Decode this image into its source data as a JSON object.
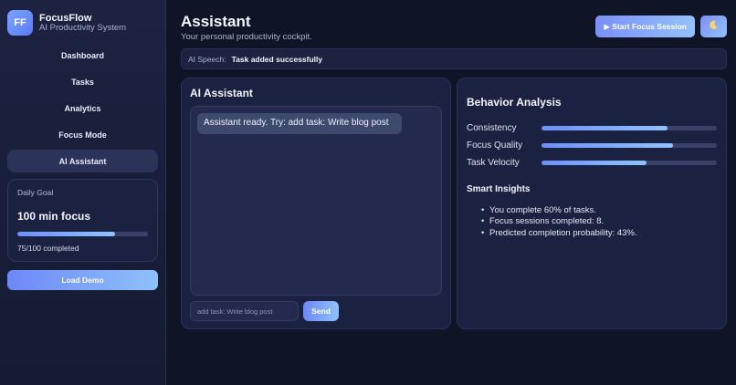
{
  "brand": {
    "logo_text": "FF",
    "name": "FocusFlow",
    "subtitle": "AI Productivity System"
  },
  "sidebar": {
    "items": [
      {
        "label": "Dashboard",
        "active": false
      },
      {
        "label": "Tasks",
        "active": false
      },
      {
        "label": "Analytics",
        "active": false
      },
      {
        "label": "Focus Mode",
        "active": false
      },
      {
        "label": "AI Assistant",
        "active": true
      }
    ],
    "daily_goal": {
      "label": "Daily Goal",
      "value": "100 min focus",
      "progress": 0.75,
      "status": "75/100 completed"
    },
    "load_demo_label": "Load Demo"
  },
  "header": {
    "title": "Assistant",
    "subtitle": "Your personal productivity cockpit.",
    "focus_button_label": "▶ Start Focus Session",
    "theme_icon": "moon-icon"
  },
  "speech": {
    "label": "AI Speech:",
    "message": "Task added successfully"
  },
  "assistant": {
    "title": "AI Assistant",
    "message": "Assistant ready. Try: add task: Write blog post",
    "input_placeholder": "add task: Write blog post",
    "send_label": "Send"
  },
  "behavior": {
    "title": "Behavior Analysis",
    "metrics": [
      {
        "label": "Consistency",
        "value": 0.72
      },
      {
        "label": "Focus Quality",
        "value": 0.75
      },
      {
        "label": "Task Velocity",
        "value": 0.6
      }
    ],
    "insights_title": "Smart Insights",
    "insights": [
      "You complete 60% of tasks.",
      "Focus sessions completed: 8.",
      "Predicted completion probability: 43%."
    ]
  },
  "colors": {
    "background": "#0f1427",
    "sidebar": "#1c2240",
    "accent_start": "#6d88f7",
    "accent_end": "#8fc1fb",
    "active_nav": "#2c3358"
  }
}
